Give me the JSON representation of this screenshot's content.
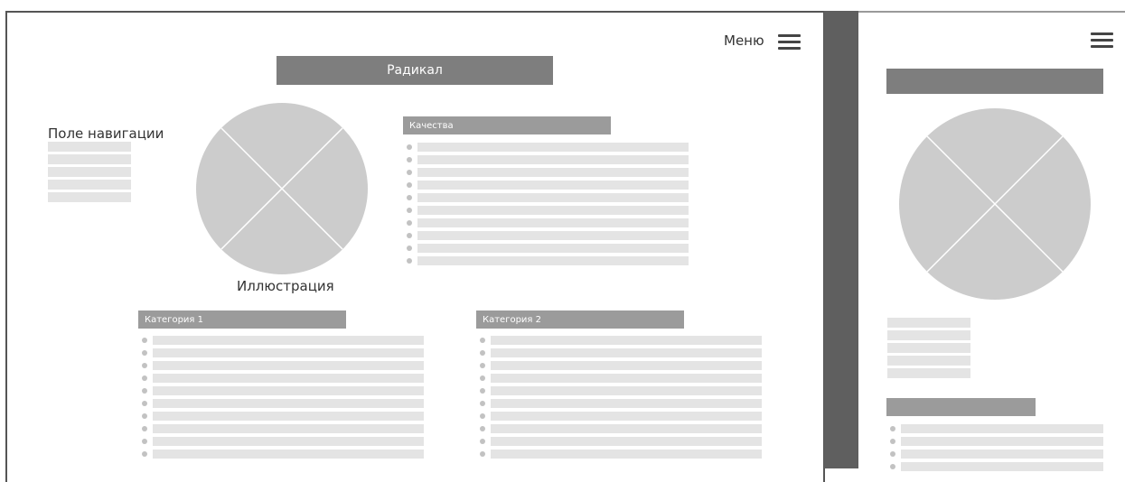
{
  "desktop": {
    "menu_label": "Меню",
    "menu_icon": "hamburger-menu-icon",
    "title": "Радикал",
    "navigation_label": "Поле навигации",
    "navigation_items": 5,
    "illustration_label": "Иллюстрация",
    "illustration_icon": "image-placeholder-icon",
    "qualities_header": "Качества",
    "qualities_items": 10,
    "category1_header": "Категория 1",
    "category1_items": 10,
    "category2_header": "Категория 2",
    "category2_items": 10
  },
  "mobile": {
    "menu_icon": "hamburger-menu-icon",
    "illustration_icon": "image-placeholder-icon",
    "navigation_items": 5,
    "list_items": 4
  },
  "colors": {
    "title_bar": "#7e7e7e",
    "section_header": "#9b9b9b",
    "placeholder_line": "#e4e4e4",
    "illustration_fill": "#cccccc",
    "divider_gutter": "#5f5f5f"
  }
}
